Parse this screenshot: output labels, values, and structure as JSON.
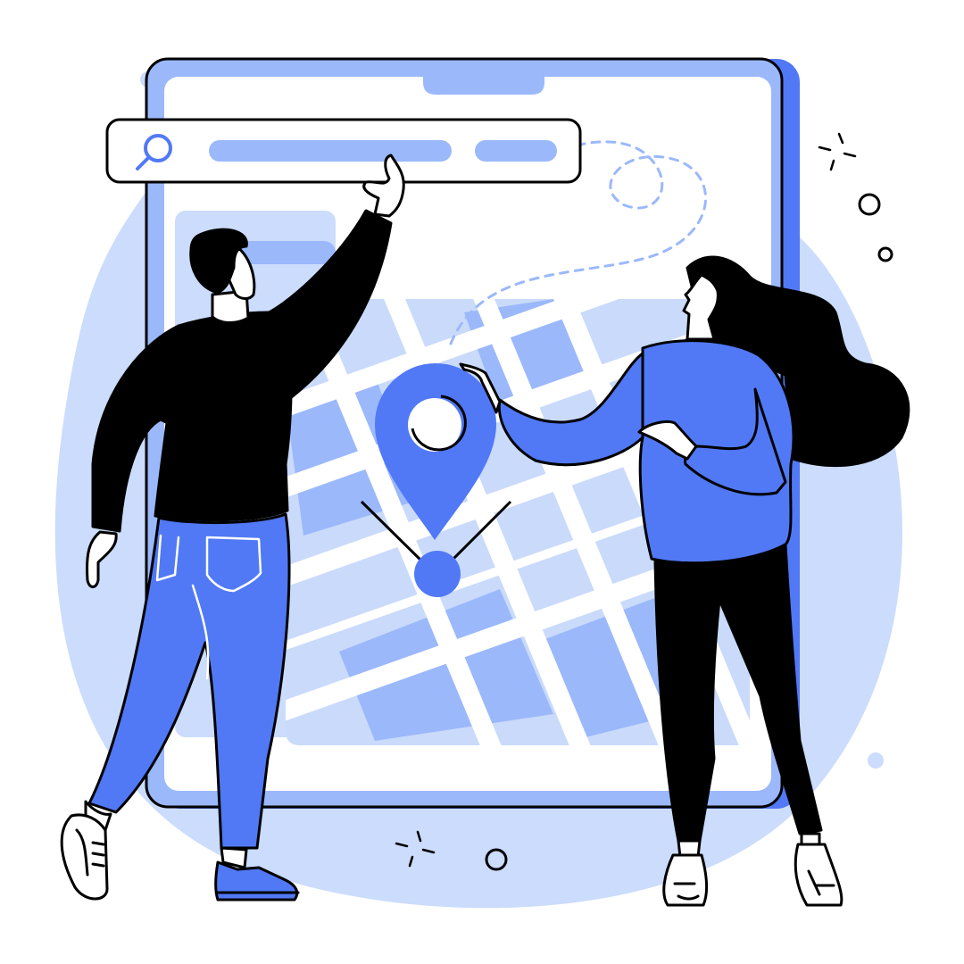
{
  "palette": {
    "background": "#ffffff",
    "blob": "#cbdcfc",
    "light_blue": "#9bb8fb",
    "mid_blue": "#5179f6",
    "map_light": "#c9dafb",
    "map_dark": "#9bb8fb",
    "outline": "#000000",
    "white": "#ffffff"
  },
  "icons": [
    "search-icon",
    "location-pin-icon",
    "dashed-route-line",
    "sparkle-icon",
    "ring-icon"
  ],
  "scene": {
    "subject": "two-people-pointing-at-map-on-tablet"
  }
}
